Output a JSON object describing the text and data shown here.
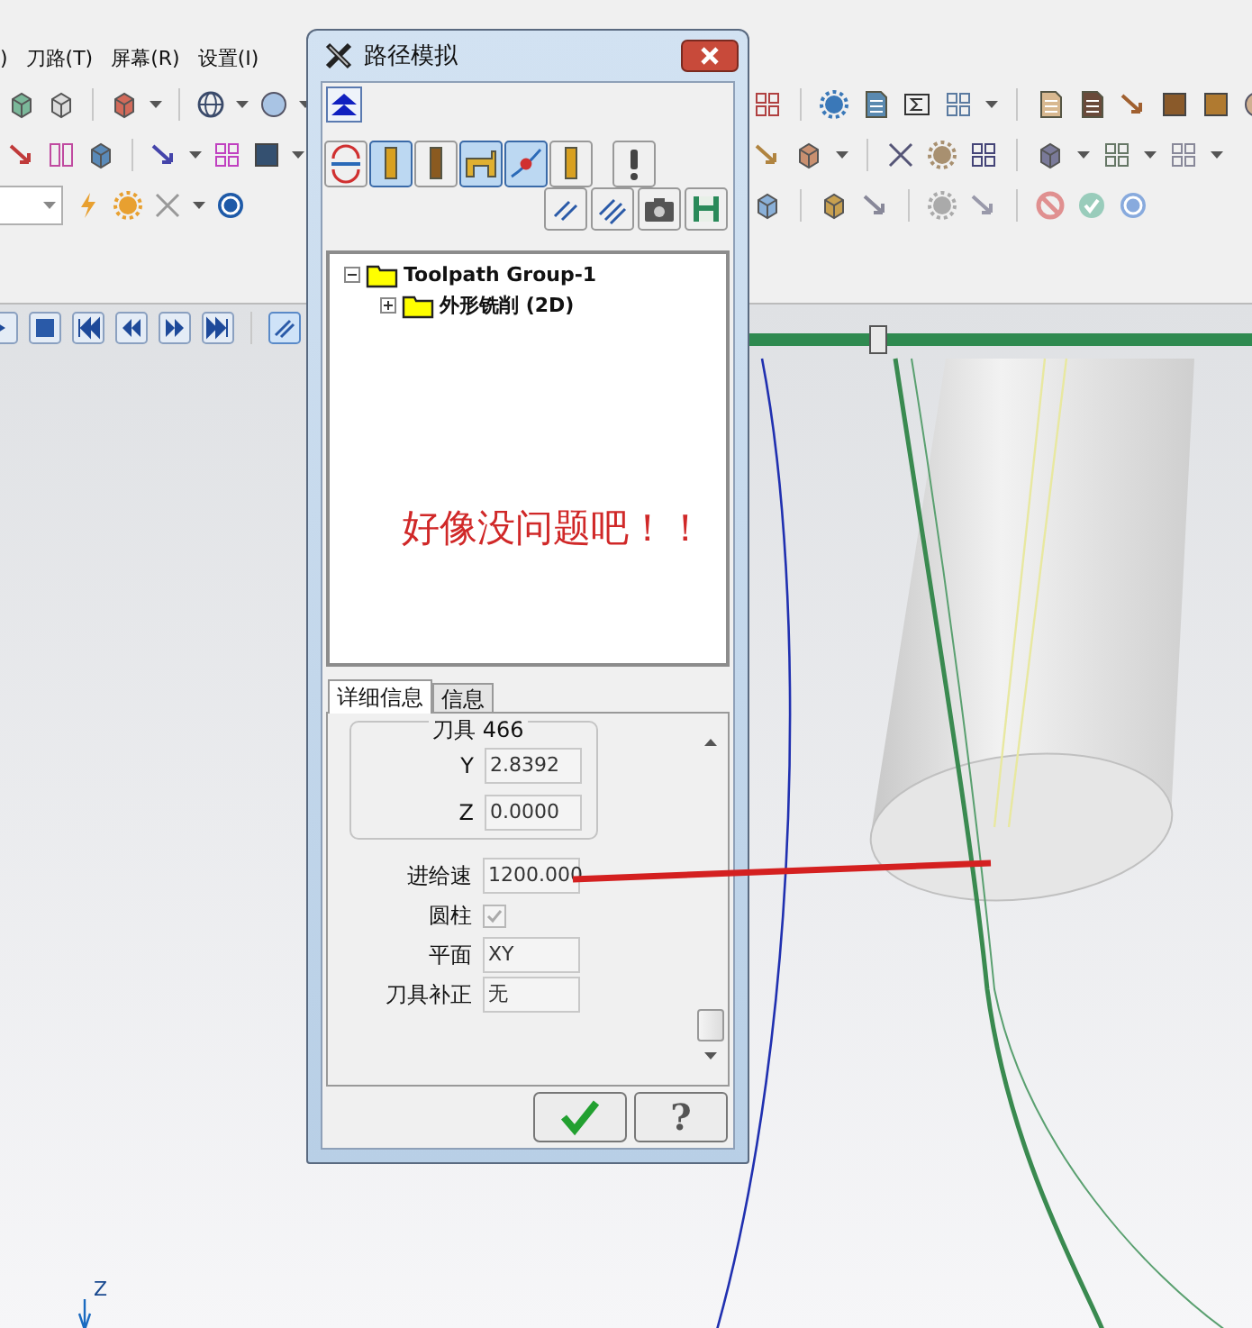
{
  "menu": [
    ")",
    "刀路(T)",
    "屏幕(R)",
    "设置(I)"
  ],
  "dialog": {
    "title": "路径模拟",
    "tool_buttons": [
      {
        "pressed": false
      },
      {
        "pressed": true
      },
      {
        "pressed": false
      },
      {
        "pressed": true
      },
      {
        "pressed": true
      },
      {
        "pressed": false
      }
    ],
    "tree": [
      {
        "label": "Toolpath Group-1",
        "expanded": true,
        "children": [
          {
            "label": "外形铣削 (2D)",
            "expanded": false
          }
        ]
      }
    ],
    "annotation": "好像没问题吧！！",
    "tabs": [
      {
        "label": "详细信息",
        "selected": true
      },
      {
        "label": "信息",
        "selected": false
      }
    ],
    "tool_label": "刀具 466",
    "coords": [
      {
        "label": "Y",
        "value": "2.8392"
      },
      {
        "label": "Z",
        "value": "0.0000"
      }
    ],
    "fields": [
      {
        "kind": "text",
        "label": "进给速",
        "value": "1200.000"
      },
      {
        "kind": "checkbox",
        "label": "圆柱",
        "checked": true,
        "disabled": true
      },
      {
        "kind": "text",
        "label": "平面",
        "value": "XY"
      },
      {
        "kind": "text",
        "label": "刀具补正",
        "value": "无"
      }
    ],
    "help_button": "?"
  },
  "viewport": {
    "axis_label": "Z"
  }
}
